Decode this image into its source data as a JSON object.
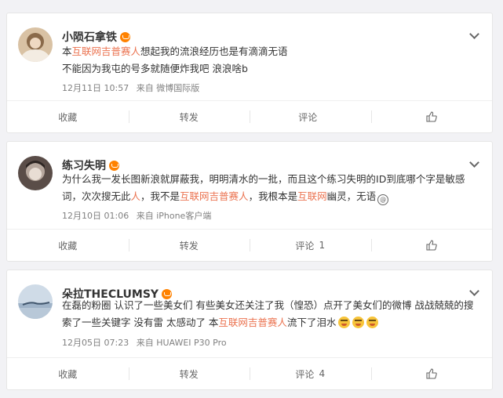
{
  "posts": [
    {
      "user": "小陨石拿铁",
      "text_parts": [
        {
          "t": "本",
          "hl": false
        },
        {
          "t": "互联网吉普赛人",
          "hl": true
        },
        {
          "t": "想起我的流浪经历也是有滴滴无语",
          "hl": false
        }
      ],
      "text_line2": "不能因为我屯的号多就随便炸我吧 浪浪啥b",
      "time": "12月11日 10:57",
      "source": "来自 微博国际版",
      "actions": {
        "fav": "收藏",
        "repost": "转发",
        "comment": "评论",
        "comment_count": ""
      }
    },
    {
      "user": "练习失明",
      "text_parts": [
        {
          "t": "为什么我一发长图新浪就屏蔽我，明明清水的一批，而且这个练习失明的ID到底哪个字是敏感词，次次搜无此",
          "hl": false
        },
        {
          "t": "人",
          "hl": true
        },
        {
          "t": "，我不是",
          "hl": false
        },
        {
          "t": "互联网吉普赛人",
          "hl": true
        },
        {
          "t": "，我根本是",
          "hl": false
        },
        {
          "t": "互联网",
          "hl": true
        },
        {
          "t": "幽灵，无语",
          "hl": false
        }
      ],
      "sticker": "@",
      "time": "12月10日 01:06",
      "source": "来自 iPhone客户端",
      "actions": {
        "fav": "收藏",
        "repost": "转发",
        "comment": "评论",
        "comment_count": "1"
      }
    },
    {
      "user": "朵拉THECLUMSY",
      "text_parts": [
        {
          "t": "在磊的粉圈 认识了一些美女们 有些美女还关注了我（惶恐）点开了美女们的微博 战战兢兢的搜索了一些关键字 没有雷 太感动了 本",
          "hl": false
        },
        {
          "t": "互联网吉普赛人",
          "hl": true
        },
        {
          "t": "流下了泪水",
          "hl": false
        }
      ],
      "time": "12月05日 07:23",
      "source": "来自 HUAWEI P30 Pro",
      "actions": {
        "fav": "收藏",
        "repost": "转发",
        "comment": "评论",
        "comment_count": "4"
      }
    }
  ]
}
